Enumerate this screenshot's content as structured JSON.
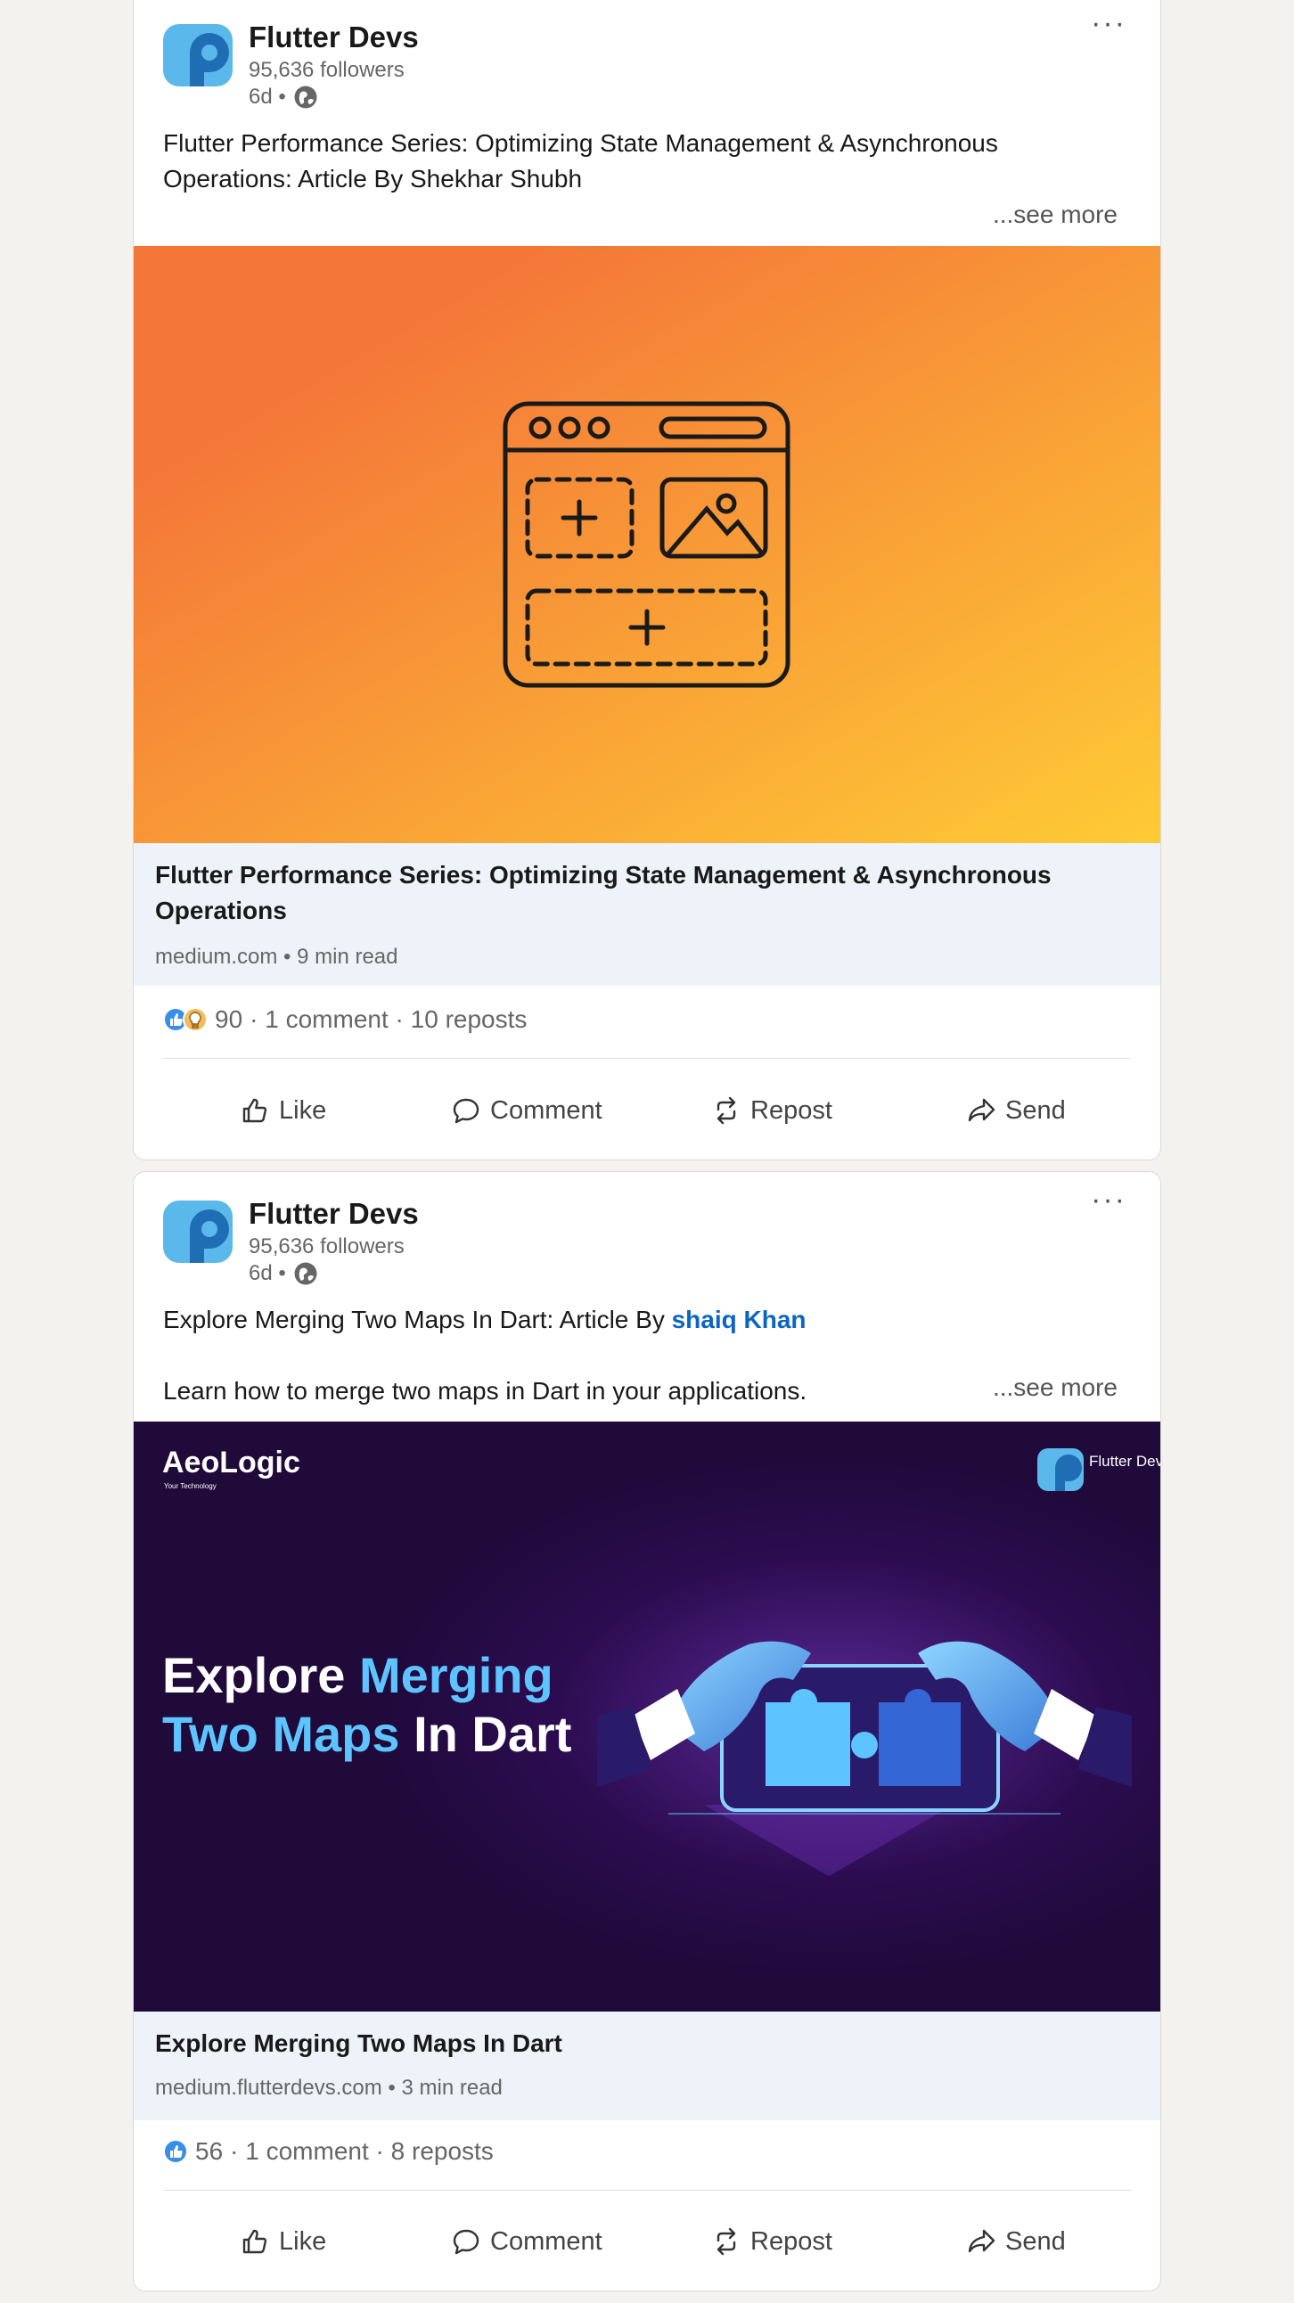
{
  "posts": [
    {
      "author": "Flutter Devs",
      "followers": "95,636 followers",
      "age": "6d •",
      "text_line1": "Flutter Performance Series: Optimizing State Management & Asynchronous",
      "text_line2": "Operations: Article By Shekhar Shubh",
      "see_more": "...see more",
      "link_title": "Flutter Performance Series: Optimizing State Management & Asynchronous Operations",
      "link_source": "medium.com • 9 min read",
      "reaction_count": "90",
      "stats_text": "· 1 comment · 10 reposts",
      "reactions": [
        "like-reaction-icon",
        "insightful-reaction-icon"
      ]
    },
    {
      "author": "Flutter Devs",
      "followers": "95,636 followers",
      "age": "6d •",
      "text_prefix": "Explore Merging Two Maps In Dart: Article By ",
      "mention": "shaiq Khan",
      "text_line2": "Learn how to merge two maps in Dart in your applications.",
      "see_more": "...see more",
      "image": {
        "brand": "AeoLogic",
        "brand_tagline": "Your Technology",
        "corner_logo": "Flutter Devs",
        "headline_white_1": "Explore ",
        "headline_blue_1": "Merging",
        "headline_blue_2": "Two Maps ",
        "headline_white_2": "In Dart"
      },
      "link_title": "Explore Merging Two Maps In Dart",
      "link_source": "medium.flutterdevs.com • 3 min read",
      "reaction_count": "56",
      "stats_text": "· 1 comment · 8 reposts",
      "reactions": [
        "like-reaction-icon"
      ]
    }
  ],
  "actions": {
    "like": "Like",
    "comment": "Comment",
    "repost": "Repost",
    "send": "Send"
  },
  "colors": {
    "brand_blue": "#0a66c2",
    "gradient_start": "#f47738",
    "gradient_end": "#fecb35",
    "promo_bg": "#1f0a3a",
    "promo_accent": "#5ec4ff"
  }
}
